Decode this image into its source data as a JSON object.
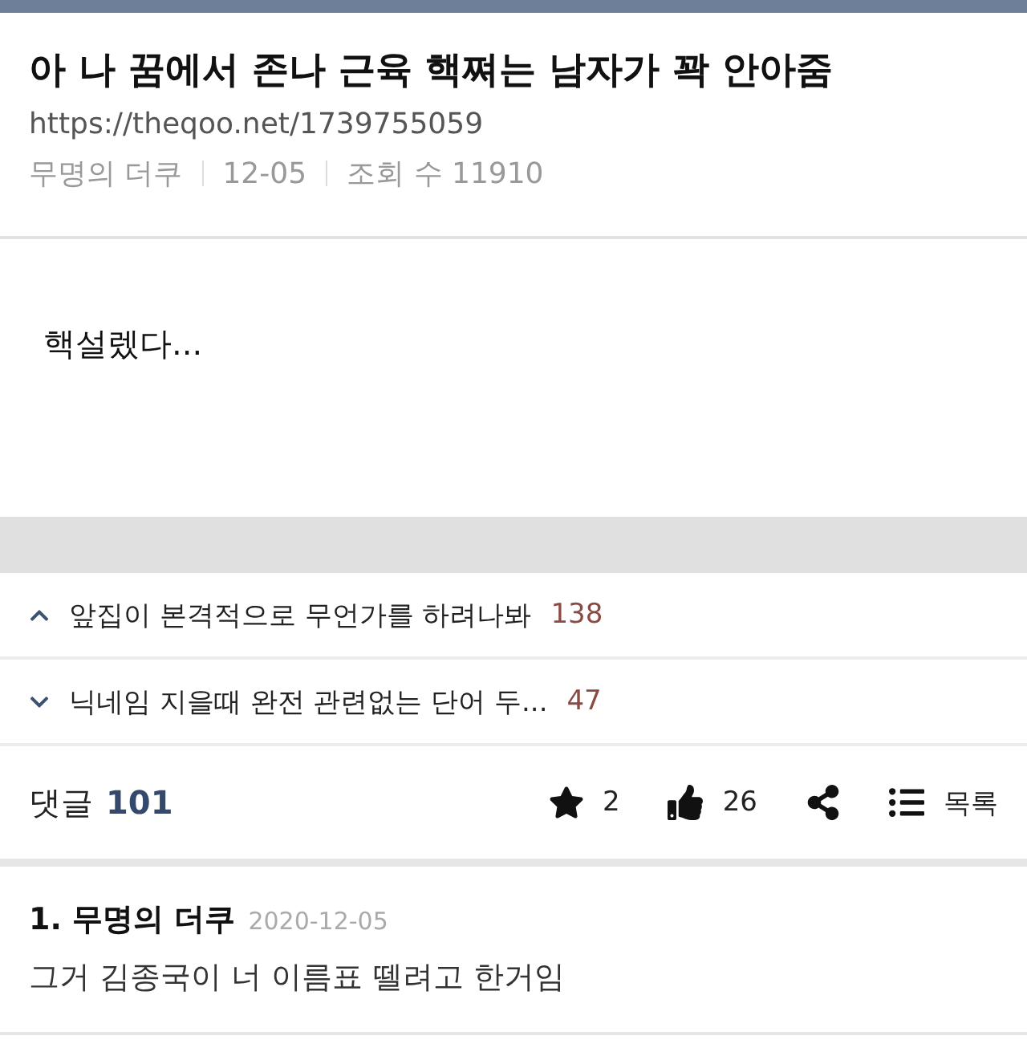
{
  "post": {
    "title": "아 나 꿈에서 존나 근육 핵쪄는 남자가 꽉 안아줌",
    "url": "https://theqoo.net/1739755059",
    "author": "무명의 더쿠",
    "date": "12-05",
    "views": "조회 수 11910",
    "body": "핵설렜다..."
  },
  "nav": [
    {
      "kind": "prev",
      "title": "앞집이 본격적으로 무언가를 하려나봐",
      "count": "138"
    },
    {
      "kind": "next",
      "title": "닉네임 지을때 완전 관련없는 단어 두...",
      "count": "47"
    }
  ],
  "comments_bar": {
    "label": "댓글",
    "count": "101",
    "actions": [
      {
        "kind": "star",
        "label": "2"
      },
      {
        "kind": "like",
        "label": "26"
      },
      {
        "kind": "share"
      },
      {
        "kind": "list",
        "label": "목록"
      }
    ]
  },
  "comments": [
    {
      "number": "1.",
      "author": "무명의 더쿠",
      "date": "2020-12-05",
      "text": "그거 김종국이 너 이름표 뗄려고 한거임"
    }
  ]
}
